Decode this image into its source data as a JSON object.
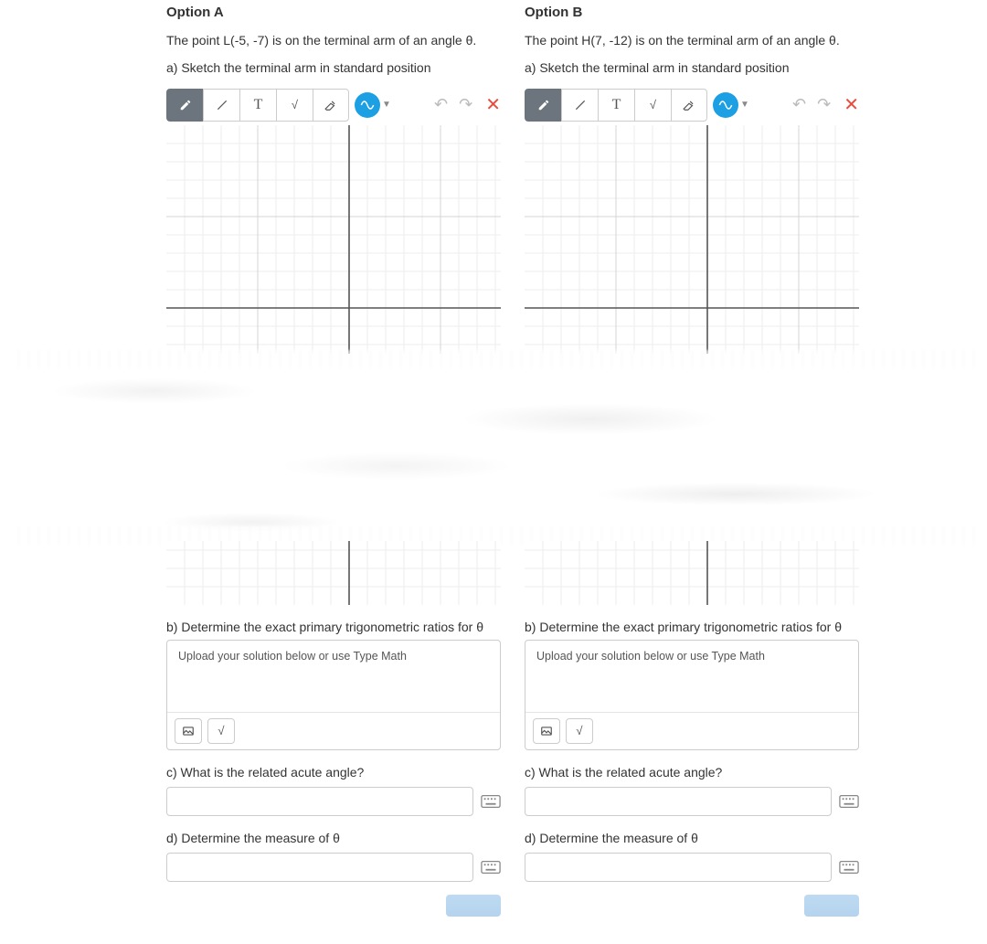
{
  "columns": [
    {
      "heading": "Option A",
      "intro": "The point L(-5, -7) is on the terminal arm of an angle θ.",
      "part_a": "a) Sketch the terminal arm in standard position",
      "part_b": "b) Determine the exact primary trigonometric ratios for θ",
      "rich_placeholder": "Upload your solution below or use Type Math",
      "part_c": "c) What is the related acute angle?",
      "part_d": "d) Determine the measure of θ"
    },
    {
      "heading": "Option B",
      "intro": "The point H(7, -12) is on the terminal arm of an angle θ.",
      "part_a": "a) Sketch the terminal arm in standard position",
      "part_b": "b) Determine the exact primary trigonometric ratios for θ",
      "rich_placeholder": "Upload your solution below or use Type Math",
      "part_c": "c) What is the related acute angle?",
      "part_d": "d) Determine the measure of θ"
    }
  ],
  "tooltips": {
    "pencil": "Draw",
    "line": "Line",
    "text": "Text",
    "math": "Math",
    "eraser": "Eraser",
    "graph": "Graph tool",
    "undo": "Undo",
    "redo": "Redo",
    "clear": "Clear",
    "image": "Insert image",
    "formula": "Insert formula",
    "keyboard": "Math keyboard"
  }
}
